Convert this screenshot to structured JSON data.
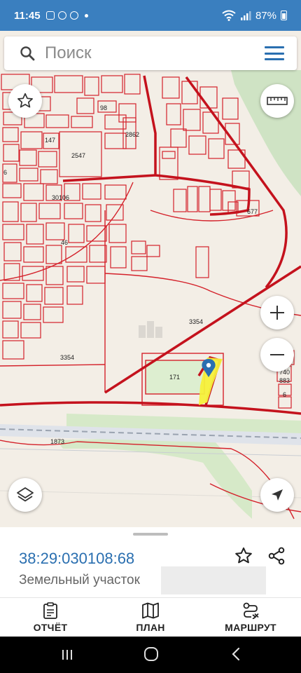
{
  "status_bar": {
    "time": "11:45",
    "battery": "87%"
  },
  "search": {
    "placeholder": "Поиск"
  },
  "map": {
    "labels": {
      "l98": "98",
      "l147": "147",
      "l2547": "2547",
      "l2862": "2862",
      "l6": "6",
      "l30106": "30106",
      "l46": "46",
      "l677": "677",
      "l3354a": "3354",
      "l3354b": "3354",
      "l171": "171",
      "l740": "740",
      "l883": "883",
      "l6b": "6",
      "l1873": "1873"
    },
    "highlight_color": "#f5f03a",
    "boundary_color": "#d4212a",
    "pin_color": "#2a6fb0"
  },
  "parcel": {
    "cadastral_number": "38:29:030108:68",
    "type": "Земельный участок"
  },
  "nav": {
    "report": "ОТЧЁТ",
    "plan": "ПЛАН",
    "route": "МАРШРУТ"
  }
}
